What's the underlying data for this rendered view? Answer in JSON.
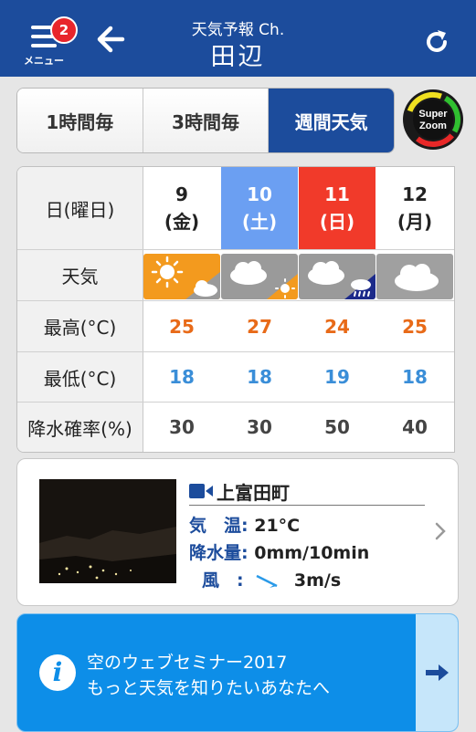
{
  "header": {
    "menu_label": "メニュー",
    "badge_count": "2",
    "subtitle": "天気予報 Ch.",
    "title": "田辺"
  },
  "tabs": [
    {
      "label": "1時間毎",
      "active": false
    },
    {
      "label": "3時間毎",
      "active": false
    },
    {
      "label": "週間天気",
      "active": true
    }
  ],
  "superzoom": {
    "line1": "Super",
    "line2": "Zoom"
  },
  "weekly": {
    "row_labels": {
      "date": "日(曜日)",
      "weather": "天気",
      "high": "最高(°C)",
      "low": "最低(°C)",
      "precip": "降水確率(%)"
    },
    "days": [
      {
        "day": "9",
        "weekday": "(金)",
        "header_color": "#ffffff",
        "weather": "sunny-then-cloudy-icon",
        "high": "25",
        "low": "18",
        "precip": "30"
      },
      {
        "day": "10",
        "weekday": "(土)",
        "header_color": "#6b9ff2",
        "weather": "cloudy-then-sunny-icon",
        "high": "27",
        "low": "18",
        "precip": "30"
      },
      {
        "day": "11",
        "weekday": "(日)",
        "header_color": "#f13a2a",
        "weather": "cloudy-then-rain-icon",
        "high": "24",
        "low": "19",
        "precip": "50"
      },
      {
        "day": "12",
        "weekday": "(月)",
        "header_color": "#ffffff",
        "weather": "cloudy-icon",
        "high": "25",
        "low": "18",
        "precip": "40"
      }
    ]
  },
  "livecam": {
    "location": "上富田町",
    "temp_label": "気　温:",
    "temp_value": "21°C",
    "rain_label": "降水量:",
    "rain_value": "0mm/10min",
    "wind_label": "風　:",
    "wind_value": "3m/s"
  },
  "banner": {
    "line1": "空のウェブセミナー2017",
    "line2": "もっと天気を知りたいあなたへ"
  },
  "colors": {
    "header_bg": "#1c4c9c",
    "high_temp": "#e86a18",
    "low_temp": "#3a8ed8",
    "banner_bg": "#0d8ee8"
  }
}
